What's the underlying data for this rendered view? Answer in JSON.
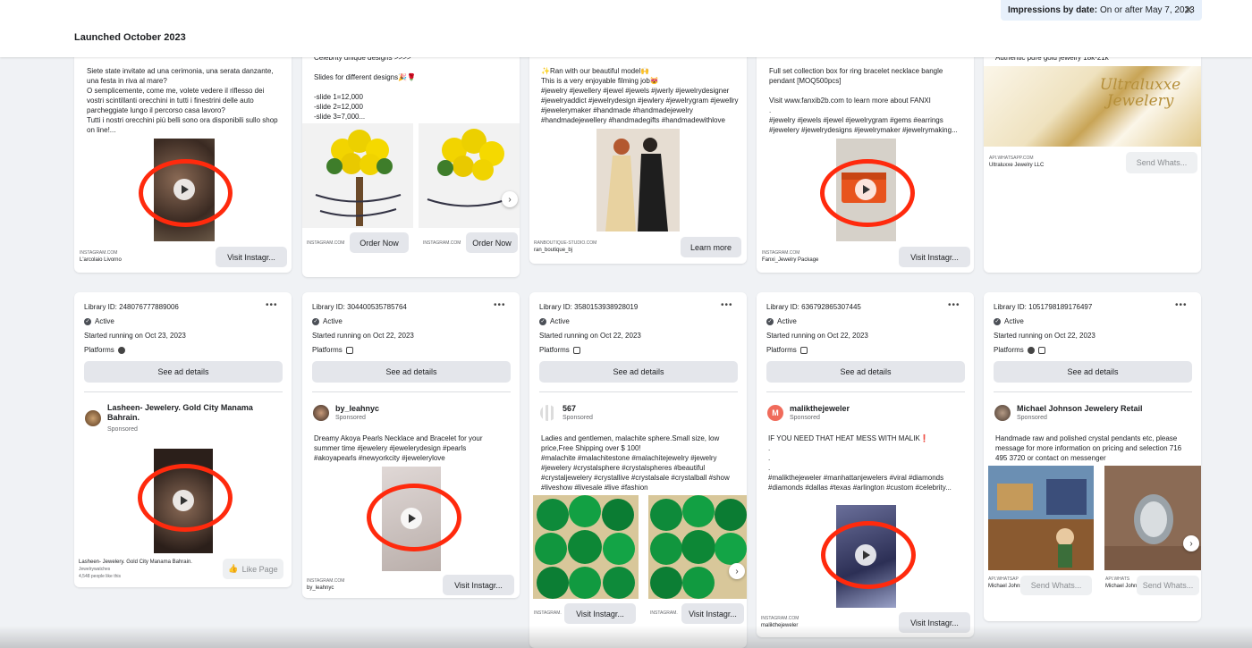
{
  "header": {
    "launched": "Launched October 2023",
    "filter_label": "Impressions by date:",
    "filter_value": "On or after May 7, 2023",
    "close_icon": "close-icon"
  },
  "top_cards": [
    {
      "body": "Siete state invitate ad una cerimonia, una serata danzante, una festa in riva al mare?\nO semplicemente, come me, volete vedere il riflesso dei vostri scintillanti orecchini in tutti i finestrini delle auto parcheggiate lungo il percorso casa lavoro?\nTutti i nostri orecchini più belli sono ora disponibili sullo shop on line!...",
      "domain": "INSTAGRAM.COM",
      "name": "L'arcolaio Livorno",
      "cta": "Visit Instagr..."
    },
    {
      "body": "Celebrity unique designs >>>>\n\nSlides for different designs🎉🌹\n\n-slide 1=12,000\n-slide 2=12,000\n-slide 3=7,000...",
      "domain1": "INSTAGRAM.COM",
      "cta1": "Order Now",
      "domain2": "INSTAGRAM.COM",
      "cta2": "Order Now"
    },
    {
      "body": "✨Ran with our beautiful model🙌\nThis is a very enjoyable filming job😻\n#jewelry #jewellery #jewel #jewels #jwerly #jewelrydesigner #jewelryaddict #jewelrydesign #jewlery #jewelrygram #jewellry #jewelerymaker #handmade #handmadejewelry #handmadejewellery #handmadegifts #handmadewithlove",
      "domain": "RANBOUTIQUE-STUDIO.COM",
      "name": "ran_boutique_bj",
      "cta": "Learn more"
    },
    {
      "body": "Full set collection box for ring bracelet necklace bangle pendant [MOQ500pcs]\n\nVisit www.fanxib2b.com to learn more about FANXI\n.\n#jewelry #jewels #jewel #jewelrygram #gems #earrings #jewelery #jewelrydesigns #jewelrymaker #jewelrymaking...",
      "domain": "INSTAGRAM.COM",
      "name": "Fanxi_Jewelry Package",
      "cta": "Visit Instagr..."
    },
    {
      "body": "Authentic pure gold jewelry 18k-21k",
      "brand_line1": "Ultraluxxe",
      "brand_line2": "Jewelery",
      "domain": "API.WHATSAPP.COM",
      "name": "Ultraluxxe Jewelry LLC",
      "cta": "Send Whats..."
    }
  ],
  "bottom_cards": [
    {
      "library_id": "Library ID: 248076777889006",
      "status": "Active",
      "started": "Started running on Oct 23, 2023",
      "platforms": "Platforms",
      "see_details": "See ad details",
      "advertiser": "Lasheen- Jewelery. Gold City Manama Bahrain.",
      "sponsored": "Sponsored",
      "body": "",
      "footer_name": "Lasheen- Jewelery. Gold City Manama Bahrain.",
      "footer_sub": "Jewelrywatches",
      "footer_likes": "4,548 people like this",
      "cta": "Like Page"
    },
    {
      "library_id": "Library ID: 304400535785764",
      "status": "Active",
      "started": "Started running on Oct 22, 2023",
      "platforms": "Platforms",
      "see_details": "See ad details",
      "advertiser": "by_leahnyc",
      "sponsored": "Sponsored",
      "body": "Dreamy Akoya Pearls Necklace and Bracelet for your summer time #jewelery #jewelerydesign #pearls #akoyapearls #newyorkcity #jewelerylove",
      "domain": "INSTAGRAM.COM",
      "footer_name": "by_leahnyc",
      "cta": "Visit Instagr..."
    },
    {
      "library_id": "Library ID: 3580153938928019",
      "status": "Active",
      "started": "Started running on Oct 22, 2023",
      "platforms": "Platforms",
      "see_details": "See ad details",
      "advertiser": "567",
      "sponsored": "Sponsored",
      "body": "Ladies and gentlemen, malachite sphere.Small size, low price,Free Shipping over $ 100!\n#malachite #malachitestone #malachitejewelry #jewelry #jewelery #crystalsphere #crystalspheres #beautiful #crystaljewelery #crystallive #crystalsale #crystalball #show #liveshow #livesale #live #fashion",
      "domain1": "INSTAGRAM.",
      "cta1": "Visit Instagr...",
      "domain2": "INSTAGRAM.",
      "cta2": "Visit Instagr..."
    },
    {
      "library_id": "Library ID: 636792865307445",
      "status": "Active",
      "started": "Started running on Oct 22, 2023",
      "platforms": "Platforms",
      "see_details": "See ad details",
      "advertiser": "malikthejeweler",
      "avatar_letter": "M",
      "sponsored": "Sponsored",
      "body": "IF YOU NEED THAT HEAT MESS WITH MALIK❗\n.\n.\n.\n#malikthejeweler #manhattanjewelers #viral #diamonds #diamonds #dallas #texas #arlington #custom #celebrity...",
      "domain": "INSTAGRAM.COM",
      "footer_name": "malikthejeweler",
      "cta": "Visit Instagr..."
    },
    {
      "library_id": "Library ID: 1051798189176497",
      "status": "Active",
      "started": "Started running on Oct 22, 2023",
      "platforms": "Platforms",
      "see_details": "See ad details",
      "advertiser": "Michael Johnson Jewelery Retail",
      "sponsored": "Sponsored",
      "body": "Handmade raw and polished crystal pendants etc, please message for more information on pricing and selection 716 495 3720 or contact on messenger",
      "domain1": "API.WHATSAP",
      "name1": "Michael Johnso...",
      "cta1": "Send Whats...",
      "domain2": "API.WHATS",
      "name2": "Michael Johnso...",
      "cta2": "Send Whats..."
    }
  ],
  "colors": {
    "highlight_ring": "#ff2a0d",
    "background": "#f0f2f5",
    "button": "#e4e6eb"
  }
}
